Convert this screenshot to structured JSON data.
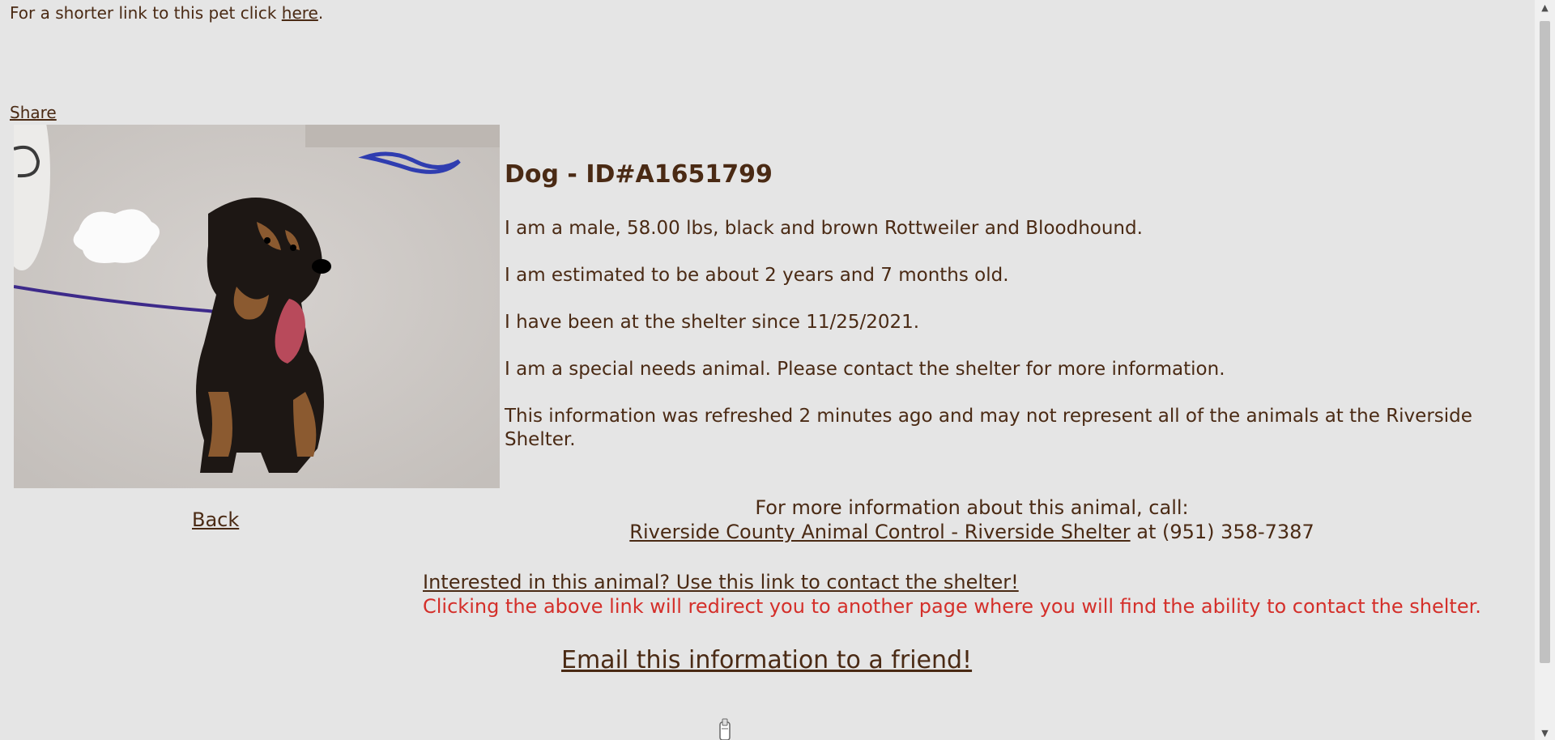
{
  "header": {
    "short_link_prefix": "For a shorter link to this pet click ",
    "short_link_text": "here",
    "short_link_suffix": ".",
    "share_label": "Share"
  },
  "animal": {
    "title": "Dog - ID#A1651799",
    "description": "I am a male, 58.00 lbs, black and brown Rottweiler and Bloodhound.",
    "age": "I am estimated to be about 2 years and 7 months old.",
    "since": "I have been at the shelter since 11/25/2021.",
    "special_needs": "I am a special needs animal. Please contact the shelter for more information.",
    "refresh_note": "This information was refreshed 2 minutes ago and may not represent all of the animals at the Riverside Shelter."
  },
  "navigation": {
    "back_label": "Back"
  },
  "contact": {
    "call_prompt": "For more information about this animal, call:",
    "shelter_name": "Riverside County Animal Control - Riverside Shelter",
    "phone_text": " at (951) 358-7387",
    "interest_link": "Interested in this animal? Use this link to contact the shelter!",
    "redirect_note": "Clicking the above link will redirect you to another page where you will find the ability to contact the shelter.",
    "email_link": "Email this information to a friend!"
  },
  "colors": {
    "background": "#e5e5e5",
    "text": "#4a2a14",
    "warning": "#d42f2a"
  },
  "icons": {
    "scroll_up": "chevron-up-icon",
    "scroll_down": "chevron-down-icon"
  }
}
